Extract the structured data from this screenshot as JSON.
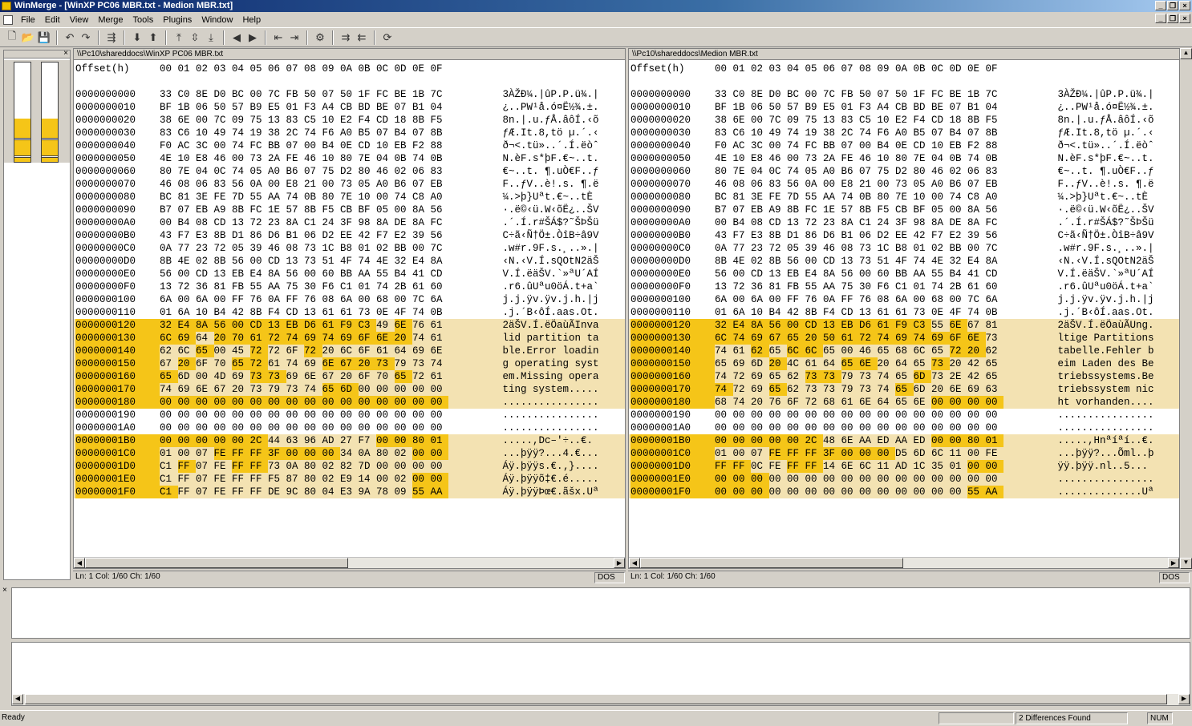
{
  "window": {
    "title": "WinMerge - [WinXP PC06 MBR.txt - Medion MBR.txt]"
  },
  "menu": [
    "File",
    "Edit",
    "View",
    "Merge",
    "Tools",
    "Plugins",
    "Window",
    "Help"
  ],
  "toolbar_icons": [
    "new-icon",
    "open-icon",
    "save-icon",
    "sep",
    "undo-icon",
    "redo-icon",
    "sep",
    "select-all-diffs-icon",
    "sep",
    "next-diff-icon",
    "prev-diff-icon",
    "sep",
    "first-diff-icon",
    "current-diff-icon",
    "last-diff-icon",
    "sep",
    "copy-left-icon",
    "copy-right-icon",
    "sep",
    "copy-all-left-icon",
    "copy-all-right-icon",
    "sep",
    "options-icon",
    "sep",
    "copy-right-advance-icon",
    "copy-left-advance-icon",
    "sep",
    "refresh-icon"
  ],
  "colors": {
    "diff": "#f5c518",
    "diff_line": "#f3e2b2",
    "titlebar": "#0a246a",
    "window": "#d4d0c8"
  },
  "header": {
    "label": "Offset(h)",
    "cols": "00 01 02 03 04 05 06 07 08 09 0A 0B 0C 0D 0E 0F"
  },
  "left": {
    "path": "\\\\Pc10\\shareddocs\\WinXP PC06 MBR.txt",
    "status": {
      "pos": "Ln: 1  Col: 1/60  Ch: 1/60",
      "eol": "DOS"
    },
    "rows": [
      {
        "off": "0000000000",
        "hex": "33 C0 8E D0 BC 00 7C FB 50 07 50 1F FC BE 1B 7C",
        "asc": "3ÀŽÐ¼.|ûP.P.ü¾.|",
        "st": "s"
      },
      {
        "off": "0000000010",
        "hex": "BF 1B 06 50 57 B9 E5 01 F3 A4 CB BD BE 07 B1 04",
        "asc": "¿..PW¹å.ó¤Ë½¾.±.",
        "st": "s"
      },
      {
        "off": "0000000020",
        "hex": "38 6E 00 7C 09 75 13 83 C5 10 E2 F4 CD 18 8B F5",
        "asc": "8n.|.u.ƒÅ.âôÍ.‹õ",
        "st": "s"
      },
      {
        "off": "0000000030",
        "hex": "83 C6 10 49 74 19 38 2C 74 F6 A0 B5 07 B4 07 8B",
        "asc": "ƒÆ.It.8,tö µ.´.‹",
        "st": "s"
      },
      {
        "off": "0000000040",
        "hex": "F0 AC 3C 00 74 FC BB 07 00 B4 0E CD 10 EB F2 88",
        "asc": "ð¬<.tü»..´.Í.ëòˆ",
        "st": "s"
      },
      {
        "off": "0000000050",
        "hex": "4E 10 E8 46 00 73 2A FE 46 10 80 7E 04 0B 74 0B",
        "asc": "N.èF.s*þF.€~..t.",
        "st": "s"
      },
      {
        "off": "0000000060",
        "hex": "80 7E 04 0C 74 05 A0 B6 07 75 D2 80 46 02 06 83",
        "asc": "€~..t. ¶.uÒ€F..ƒ",
        "st": "s"
      },
      {
        "off": "0000000070",
        "hex": "46 08 06 83 56 0A 00 E8 21 00 73 05 A0 B6 07 EB",
        "asc": "F..ƒV..è!.s. ¶.ë",
        "st": "s"
      },
      {
        "off": "0000000080",
        "hex": "BC 81 3E FE 7D 55 AA 74 0B 80 7E 10 00 74 C8 A0",
        "asc": "¼.>þ}Uªt.€~..tÈ ",
        "st": "s"
      },
      {
        "off": "0000000090",
        "hex": "B7 07 EB A9 8B FC 1E 57 8B F5 CB BF 05 00 8A 56",
        "asc": "·.ë©‹ü.W‹õË¿..ŠV",
        "st": "s"
      },
      {
        "off": "00000000A0",
        "hex": "00 B4 08 CD 13 72 23 8A C1 24 3F 98 8A DE 8A FC",
        "asc": ".´.Í.r#ŠÁ$?˜ŠÞŠü",
        "st": "s"
      },
      {
        "off": "00000000B0",
        "hex": "43 F7 E3 8B D1 86 D6 B1 06 D2 EE 42 F7 E2 39 56",
        "asc": "C÷ã‹Ñ†Ö±.ÒîB÷â9V",
        "st": "s"
      },
      {
        "off": "00000000C0",
        "hex": "0A 77 23 72 05 39 46 08 73 1C B8 01 02 BB 00 7C",
        "asc": ".w#r.9F.s.¸..».|",
        "st": "s"
      },
      {
        "off": "00000000D0",
        "hex": "8B 4E 02 8B 56 00 CD 13 73 51 4F 74 4E 32 E4 8A",
        "asc": "‹N.‹V.Í.sQOtN2äŠ",
        "st": "s"
      },
      {
        "off": "00000000E0",
        "hex": "56 00 CD 13 EB E4 8A 56 00 60 BB AA 55 B4 41 CD",
        "asc": "V.Í.ëäŠV.`»ªU´AÍ",
        "st": "s"
      },
      {
        "off": "00000000F0",
        "hex": "13 72 36 81 FB 55 AA 75 30 F6 C1 01 74 2B 61 60",
        "asc": ".r6.ûUªu0öÁ.t+a`",
        "st": "s"
      },
      {
        "off": "0000000100",
        "hex": "6A 00 6A 00 FF 76 0A FF 76 08 6A 00 68 00 7C 6A",
        "asc": "j.j.ÿv.ÿv.j.h.|j",
        "st": "s"
      },
      {
        "off": "0000000110",
        "hex": "01 6A 10 B4 42 8B F4 CD 13 61 61 73 0E 4F 74 0B",
        "asc": ".j.´B‹ôÍ.aas.Ot.",
        "st": "s"
      },
      {
        "off": "0000000120",
        "hex": "32 E4 8A 56 00 CD 13 EB D6 61 F9 C3 49 6E 76 61",
        "asc": "2äŠV.Í.ëÖaùÃInva",
        "st": "d",
        "dm": "111111111111010000"
      },
      {
        "off": "0000000130",
        "hex": "6C 69 64 20 70 61 72 74 69 74 69 6F 6E 20 74 61",
        "asc": "lid partition ta",
        "st": "d",
        "dm": "1101111111111100"
      },
      {
        "off": "0000000140",
        "hex": "62 6C 65 00 45 72 72 6F 72 20 6C 6F 61 64 69 6E",
        "asc": "ble.Error loadin",
        "st": "d",
        "dm": "0010010010000000"
      },
      {
        "off": "0000000150",
        "hex": "67 20 6F 70 65 72 61 74 69 6E 67 20 73 79 73 74",
        "asc": "g operating syst",
        "st": "d",
        "dm": "0100110001111000"
      },
      {
        "off": "0000000160",
        "hex": "65 6D 00 4D 69 73 73 69 6E 67 20 6F 70 65 72 61",
        "asc": "em.Missing opera",
        "st": "d",
        "dm": "1000011000000100"
      },
      {
        "off": "0000000170",
        "hex": "74 69 6E 67 20 73 79 73 74 65 6D 00 00 00 00 00",
        "asc": "ting system.....",
        "st": "d",
        "dm": "0000000001100000"
      },
      {
        "off": "0000000180",
        "hex": "00 00 00 00 00 00 00 00 00 00 00 00 00 00 00 00",
        "asc": "................",
        "st": "d",
        "dm": "1111111111111111"
      },
      {
        "off": "0000000190",
        "hex": "00 00 00 00 00 00 00 00 00 00 00 00 00 00 00 00",
        "asc": "................",
        "st": "s"
      },
      {
        "off": "00000001A0",
        "hex": "00 00 00 00 00 00 00 00 00 00 00 00 00 00 00 00",
        "asc": "................",
        "st": "s"
      },
      {
        "off": "00000001B0",
        "hex": "00 00 00 00 00 2C 44 63 96 AD 27 F7 00 00 80 01",
        "asc": ".....,Dc–­'÷..€.",
        "st": "d",
        "dm": "1111110000001111"
      },
      {
        "off": "00000001C0",
        "hex": "01 00 07 FE FF FF 3F 00 00 00 34 0A 80 02 00 00",
        "asc": "...þÿÿ?...4.€...",
        "st": "d",
        "dm": "0001111111000011"
      },
      {
        "off": "00000001D0",
        "hex": "C1 FF 07 FE FF FF 73 0A 80 02 82 7D 00 00 00 00",
        "asc": "Áÿ.þÿÿs.€.‚}....",
        "st": "d",
        "dm": "0100110000000000"
      },
      {
        "off": "00000001E0",
        "hex": "C1 FF 07 FE FF FF F5 87 80 02 E9 14 00 02 00 00",
        "asc": "Áÿ.þÿÿõ‡€.é.....",
        "st": "d",
        "dm": "0000000000000011"
      },
      {
        "off": "00000001F0",
        "hex": "C1 FF 07 FE FF FF DE 9C 80 04 E3 9A 78 09 55 AA",
        "asc": "Áÿ.þÿÿÞœ€.ãšx.Uª",
        "st": "d",
        "dm": "1000000000000011"
      }
    ]
  },
  "right": {
    "path": "\\\\Pc10\\shareddocs\\Medion MBR.txt",
    "status": {
      "pos": "Ln: 1  Col: 1/60  Ch: 1/60",
      "eol": "DOS"
    },
    "rows": [
      {
        "off": "0000000000",
        "hex": "33 C0 8E D0 BC 00 7C FB 50 07 50 1F FC BE 1B 7C",
        "asc": "3ÀŽÐ¼.|ûP.P.ü¾.|",
        "st": "s"
      },
      {
        "off": "0000000010",
        "hex": "BF 1B 06 50 57 B9 E5 01 F3 A4 CB BD BE 07 B1 04",
        "asc": "¿..PW¹å.ó¤Ë½¾.±.",
        "st": "s"
      },
      {
        "off": "0000000020",
        "hex": "38 6E 00 7C 09 75 13 83 C5 10 E2 F4 CD 18 8B F5",
        "asc": "8n.|.u.ƒÅ.âôÍ.‹õ",
        "st": "s"
      },
      {
        "off": "0000000030",
        "hex": "83 C6 10 49 74 19 38 2C 74 F6 A0 B5 07 B4 07 8B",
        "asc": "ƒÆ.It.8,tö µ.´.‹",
        "st": "s"
      },
      {
        "off": "0000000040",
        "hex": "F0 AC 3C 00 74 FC BB 07 00 B4 0E CD 10 EB F2 88",
        "asc": "ð¬<.tü»..´.Í.ëòˆ",
        "st": "s"
      },
      {
        "off": "0000000050",
        "hex": "4E 10 E8 46 00 73 2A FE 46 10 80 7E 04 0B 74 0B",
        "asc": "N.èF.s*þF.€~..t.",
        "st": "s"
      },
      {
        "off": "0000000060",
        "hex": "80 7E 04 0C 74 05 A0 B6 07 75 D2 80 46 02 06 83",
        "asc": "€~..t. ¶.uÒ€F..ƒ",
        "st": "s"
      },
      {
        "off": "0000000070",
        "hex": "46 08 06 83 56 0A 00 E8 21 00 73 05 A0 B6 07 EB",
        "asc": "F..ƒV..è!.s. ¶.ë",
        "st": "s"
      },
      {
        "off": "0000000080",
        "hex": "BC 81 3E FE 7D 55 AA 74 0B 80 7E 10 00 74 C8 A0",
        "asc": "¼.>þ}Uªt.€~..tÈ ",
        "st": "s"
      },
      {
        "off": "0000000090",
        "hex": "B7 07 EB A9 8B FC 1E 57 8B F5 CB BF 05 00 8A 56",
        "asc": "·.ë©‹ü.W‹õË¿..ŠV",
        "st": "s"
      },
      {
        "off": "00000000A0",
        "hex": "00 B4 08 CD 13 72 23 8A C1 24 3F 98 8A DE 8A FC",
        "asc": ".´.Í.r#ŠÁ$?˜ŠÞŠü",
        "st": "s"
      },
      {
        "off": "00000000B0",
        "hex": "43 F7 E3 8B D1 86 D6 B1 06 D2 EE 42 F7 E2 39 56",
        "asc": "C÷ã‹Ñ†Ö±.ÒîB÷â9V",
        "st": "s"
      },
      {
        "off": "00000000C0",
        "hex": "0A 77 23 72 05 39 46 08 73 1C B8 01 02 BB 00 7C",
        "asc": ".w#r.9F.s.¸..».|",
        "st": "s"
      },
      {
        "off": "00000000D0",
        "hex": "8B 4E 02 8B 56 00 CD 13 73 51 4F 74 4E 32 E4 8A",
        "asc": "‹N.‹V.Í.sQOtN2äŠ",
        "st": "s"
      },
      {
        "off": "00000000E0",
        "hex": "56 00 CD 13 EB E4 8A 56 00 60 BB AA 55 B4 41 CD",
        "asc": "V.Í.ëäŠV.`»ªU´AÍ",
        "st": "s"
      },
      {
        "off": "00000000F0",
        "hex": "13 72 36 81 FB 55 AA 75 30 F6 C1 01 74 2B 61 60",
        "asc": ".r6.ûUªu0öÁ.t+a`",
        "st": "s"
      },
      {
        "off": "0000000100",
        "hex": "6A 00 6A 00 FF 76 0A FF 76 08 6A 00 68 00 7C 6A",
        "asc": "j.j.ÿv.ÿv.j.h.|j",
        "st": "s"
      },
      {
        "off": "0000000110",
        "hex": "01 6A 10 B4 42 8B F4 CD 13 61 61 73 0E 4F 74 0B",
        "asc": ".j.´B‹ôÍ.aas.Ot.",
        "st": "s"
      },
      {
        "off": "0000000120",
        "hex": "32 E4 8A 56 00 CD 13 EB D6 61 F9 C3 55 6E 67 81",
        "asc": "2äŠV.Í.ëÖaùÃUng.",
        "st": "d",
        "dm": "1111111111110100"
      },
      {
        "off": "0000000130",
        "hex": "6C 74 69 67 65 20 50 61 72 74 69 74 69 6F 6E 73",
        "asc": "ltige Partitions",
        "st": "d",
        "dm": "1111111111111110"
      },
      {
        "off": "0000000140",
        "hex": "74 61 62 65 6C 6C 65 00 46 65 68 6C 65 72 20 62",
        "asc": "tabelle.Fehler b",
        "st": "d",
        "dm": "0010110000000110"
      },
      {
        "off": "0000000150",
        "hex": "65 69 6D 20 4C 61 64 65 6E 20 64 65 73 20 42 65",
        "asc": "eim Laden des Be",
        "st": "d",
        "dm": "0001000110001000"
      },
      {
        "off": "0000000160",
        "hex": "74 72 69 65 62 73 73 79 73 74 65 6D 73 2E 42 65",
        "asc": "triebssystems.Be",
        "st": "d",
        "dm": "0000011000010000"
      },
      {
        "off": "0000000170",
        "hex": "74 72 69 65 62 73 73 79 73 74 65 6D 20 6E 69 63",
        "asc": "triebssystem nic",
        "st": "d",
        "dm": "1001000000100000"
      },
      {
        "off": "0000000180",
        "hex": "68 74 20 76 6F 72 68 61 6E 64 65 6E 00 00 00 00",
        "asc": "ht vorhanden....",
        "st": "d",
        "dm": "0000000000001111"
      },
      {
        "off": "0000000190",
        "hex": "00 00 00 00 00 00 00 00 00 00 00 00 00 00 00 00",
        "asc": "................",
        "st": "s"
      },
      {
        "off": "00000001A0",
        "hex": "00 00 00 00 00 00 00 00 00 00 00 00 00 00 00 00",
        "asc": "................",
        "st": "s"
      },
      {
        "off": "00000001B0",
        "hex": "00 00 00 00 00 2C 48 6E AA ED AA ED 00 00 80 01",
        "asc": ".....,Hnªíªí..€.",
        "st": "d",
        "dm": "1111110000001111"
      },
      {
        "off": "00000001C0",
        "hex": "01 00 07 FE FF FF 3F 00 00 00 D5 6D 6C 11 00 FE",
        "asc": "...þÿÿ?...Õml..þ",
        "st": "d",
        "dm": "0001111111000000"
      },
      {
        "off": "00000001D0",
        "hex": "FF FF 0C FE FF FF 14 6E 6C 11 AD 1C 35 01 00 00",
        "asc": "ÿÿ.þÿÿ.nl.­.5...",
        "st": "d",
        "dm": "1100110000000011"
      },
      {
        "off": "00000001E0",
        "hex": "00 00 00 00 00 00 00 00 00 00 00 00 00 00 00 00",
        "asc": "................",
        "st": "d",
        "dm": "1110000000000000"
      },
      {
        "off": "00000001F0",
        "hex": "00 00 00 00 00 00 00 00 00 00 00 00 00 00 55 AA",
        "asc": "..............Uª",
        "st": "d",
        "dm": "1110000000000011"
      }
    ]
  },
  "status": {
    "ready": "Ready",
    "diffs": "2 Differences Found",
    "num": "NUM"
  }
}
